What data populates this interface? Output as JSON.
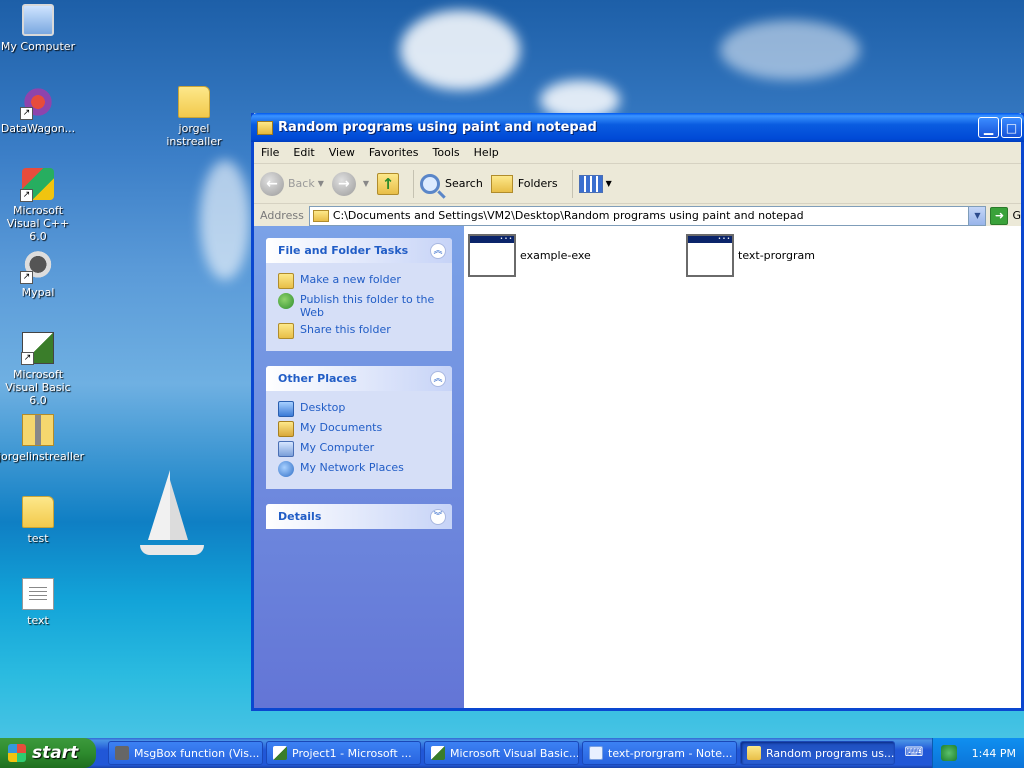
{
  "desktop": {
    "icons": [
      {
        "label": "My Computer"
      },
      {
        "label": "DataWagon..."
      },
      {
        "label": "jorgel instrealler"
      },
      {
        "label": "Microsoft Visual C++ 6.0"
      },
      {
        "label": "Mypal"
      },
      {
        "label": "Microsoft Visual Basic 6.0"
      },
      {
        "label": "jorgelinstrealler"
      },
      {
        "label": "test"
      },
      {
        "label": "text"
      }
    ]
  },
  "window": {
    "title": "Random programs using paint and notepad",
    "menu": [
      "File",
      "Edit",
      "View",
      "Favorites",
      "Tools",
      "Help"
    ],
    "toolbar": {
      "back": "Back",
      "search": "Search",
      "folders": "Folders"
    },
    "address": {
      "label": "Address",
      "value": "C:\\Documents and Settings\\VM2\\Desktop\\Random programs using paint and notepad",
      "go": "G"
    },
    "panels": {
      "file_tasks": {
        "title": "File and Folder Tasks",
        "items": [
          "Make a new folder",
          "Publish this folder to the Web",
          "Share this folder"
        ]
      },
      "other_places": {
        "title": "Other Places",
        "items": [
          "Desktop",
          "My Documents",
          "My Computer",
          "My Network Places"
        ]
      },
      "details": {
        "title": "Details"
      }
    },
    "files": [
      {
        "name": "example-exe"
      },
      {
        "name": "text-prorgram"
      }
    ]
  },
  "taskbar": {
    "start": "start",
    "buttons": [
      {
        "label": "MsgBox function (Vis..."
      },
      {
        "label": "Project1 - Microsoft ..."
      },
      {
        "label": "Microsoft Visual Basic..."
      },
      {
        "label": "text-prorgram - Note..."
      },
      {
        "label": "Random programs us..."
      }
    ],
    "clock": "1:44 PM"
  }
}
